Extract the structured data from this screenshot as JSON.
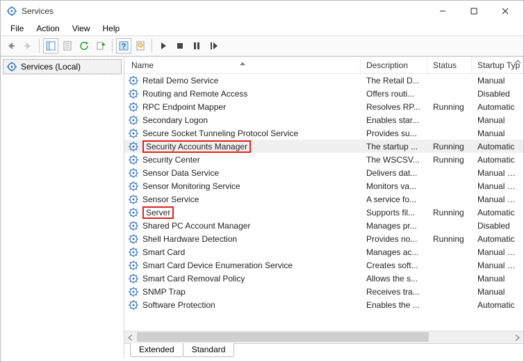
{
  "window": {
    "title": "Services"
  },
  "menu": {
    "file": "File",
    "action": "Action",
    "view": "View",
    "help": "Help"
  },
  "tree": {
    "root": "Services (Local)"
  },
  "columns": {
    "name": "Name",
    "description": "Description",
    "status": "Status",
    "startup": "Startup Typ"
  },
  "tabs": {
    "extended": "Extended",
    "standard": "Standard"
  },
  "services": [
    {
      "name": "Retail Demo Service",
      "description": "The Retail D...",
      "status": "",
      "startup": "Manual"
    },
    {
      "name": "Routing and Remote Access",
      "description": "Offers routi...",
      "status": "",
      "startup": "Disabled"
    },
    {
      "name": "RPC Endpoint Mapper",
      "description": "Resolves RP...",
      "status": "Running",
      "startup": "Automatic"
    },
    {
      "name": "Secondary Logon",
      "description": "Enables star...",
      "status": "",
      "startup": "Manual"
    },
    {
      "name": "Secure Socket Tunneling Protocol Service",
      "description": "Provides su...",
      "status": "",
      "startup": "Manual"
    },
    {
      "name": "Security Accounts Manager",
      "description": "The startup ...",
      "status": "Running",
      "startup": "Automatic",
      "selected": true,
      "highlight": true
    },
    {
      "name": "Security Center",
      "description": "The WSCSV...",
      "status": "Running",
      "startup": "Automatic"
    },
    {
      "name": "Sensor Data Service",
      "description": "Delivers dat...",
      "status": "",
      "startup": "Manual (Tri"
    },
    {
      "name": "Sensor Monitoring Service",
      "description": "Monitors va...",
      "status": "",
      "startup": "Manual (Tri"
    },
    {
      "name": "Sensor Service",
      "description": "A service fo...",
      "status": "",
      "startup": "Manual (Tri"
    },
    {
      "name": "Server",
      "description": "Supports fil...",
      "status": "Running",
      "startup": "Automatic",
      "highlight": true
    },
    {
      "name": "Shared PC Account Manager",
      "description": "Manages pr...",
      "status": "",
      "startup": "Disabled"
    },
    {
      "name": "Shell Hardware Detection",
      "description": "Provides no...",
      "status": "Running",
      "startup": "Automatic"
    },
    {
      "name": "Smart Card",
      "description": "Manages ac...",
      "status": "",
      "startup": "Manual (Tri"
    },
    {
      "name": "Smart Card Device Enumeration Service",
      "description": "Creates soft...",
      "status": "",
      "startup": "Manual (Tri"
    },
    {
      "name": "Smart Card Removal Policy",
      "description": "Allows the s...",
      "status": "",
      "startup": "Manual"
    },
    {
      "name": "SNMP Trap",
      "description": "Receives tra...",
      "status": "",
      "startup": "Manual"
    },
    {
      "name": "Software Protection",
      "description": "Enables the ...",
      "status": "",
      "startup": "Automatic"
    }
  ]
}
